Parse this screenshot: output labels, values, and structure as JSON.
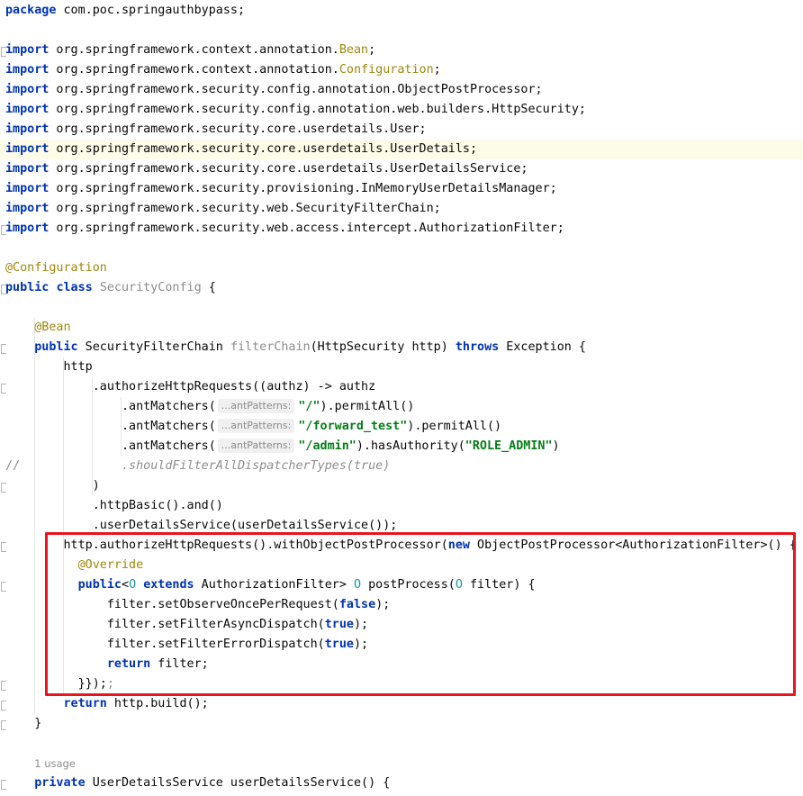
{
  "editor": {
    "lines": [
      {
        "tokens": [
          {
            "t": "package",
            "c": "kw"
          },
          {
            "t": " com.poc.springauthbypass;"
          }
        ]
      },
      {
        "tokens": []
      },
      {
        "tokens": [
          {
            "t": "import",
            "c": "kw"
          },
          {
            "t": " org.springframework.context.annotation."
          },
          {
            "t": "Bean",
            "c": "cls"
          },
          {
            "t": ";"
          }
        ]
      },
      {
        "tokens": [
          {
            "t": "import",
            "c": "kw"
          },
          {
            "t": " org.springframework.context.annotation."
          },
          {
            "t": "Configuration",
            "c": "cls"
          },
          {
            "t": ";"
          }
        ]
      },
      {
        "tokens": [
          {
            "t": "import",
            "c": "kw"
          },
          {
            "t": " org.springframework.security.config.annotation.ObjectPostProcessor;"
          }
        ]
      },
      {
        "tokens": [
          {
            "t": "import",
            "c": "kw"
          },
          {
            "t": " org.springframework.security.config.annotation.web.builders.HttpSecurity;"
          }
        ]
      },
      {
        "tokens": [
          {
            "t": "import",
            "c": "kw"
          },
          {
            "t": " org.springframework.security.core.userdetails.User;"
          }
        ]
      },
      {
        "tokens": [
          {
            "t": "import",
            "c": "kw"
          },
          {
            "t": " org.springframework.security.core.userdetails.UserDetails;"
          }
        ],
        "caret": true
      },
      {
        "tokens": [
          {
            "t": "import",
            "c": "kw"
          },
          {
            "t": " org.springframework.security.core.userdetails.UserDetailsService;"
          }
        ]
      },
      {
        "tokens": [
          {
            "t": "import",
            "c": "kw"
          },
          {
            "t": " org.springframework.security.provisioning.InMemoryUserDetailsManager;"
          }
        ]
      },
      {
        "tokens": [
          {
            "t": "import",
            "c": "kw"
          },
          {
            "t": " org.springframework.security.web.SecurityFilterChain;"
          }
        ]
      },
      {
        "tokens": [
          {
            "t": "import",
            "c": "kw"
          },
          {
            "t": " org.springframework.security.web.access.intercept.AuthorizationFilter;"
          }
        ]
      },
      {
        "tokens": []
      },
      {
        "tokens": [
          {
            "t": "@Configuration",
            "c": "ann"
          }
        ]
      },
      {
        "tokens": [
          {
            "t": "public",
            "c": "kw"
          },
          {
            "t": " "
          },
          {
            "t": "class",
            "c": "kw"
          },
          {
            "t": " "
          },
          {
            "t": "SecurityConfig",
            "c": "gray"
          },
          {
            "t": " {"
          }
        ]
      },
      {
        "tokens": []
      },
      {
        "tokens": [
          {
            "t": "    "
          },
          {
            "t": "@Bean",
            "c": "ann"
          }
        ]
      },
      {
        "tokens": [
          {
            "t": "    "
          },
          {
            "t": "public",
            "c": "kw"
          },
          {
            "t": " SecurityFilterChain "
          },
          {
            "t": "filterChain",
            "c": "gray"
          },
          {
            "t": "(HttpSecurity http) "
          },
          {
            "t": "throws",
            "c": "kw"
          },
          {
            "t": " Exception {"
          }
        ]
      },
      {
        "tokens": [
          {
            "t": "        http"
          }
        ]
      },
      {
        "tokens": [
          {
            "t": "            .authorizeHttpRequests((authz) -> authz"
          }
        ]
      },
      {
        "tokens": [
          {
            "t": "                .antMatchers("
          },
          {
            "t": "...antPatterns:",
            "c": "hint"
          },
          {
            "t": "\"/\"",
            "c": "str"
          },
          {
            "t": ").permitAll()"
          }
        ]
      },
      {
        "tokens": [
          {
            "t": "                .antMatchers("
          },
          {
            "t": "...antPatterns:",
            "c": "hint"
          },
          {
            "t": "\"/forward_test\"",
            "c": "str"
          },
          {
            "t": ").permitAll()"
          }
        ]
      },
      {
        "tokens": [
          {
            "t": "                .antMatchers("
          },
          {
            "t": "...antPatterns:",
            "c": "hint"
          },
          {
            "t": "\"/admin\"",
            "c": "str"
          },
          {
            "t": ").hasAuthority("
          },
          {
            "t": "\"ROLE_ADMIN\"",
            "c": "str"
          },
          {
            "t": ")"
          }
        ]
      },
      {
        "tokens": [
          {
            "t": "                "
          },
          {
            "t": ".shouldFilterAllDispatcherTypes(true)",
            "c": "gray italic"
          }
        ],
        "gutter_comment": "//"
      },
      {
        "tokens": [
          {
            "t": "            )"
          }
        ]
      },
      {
        "tokens": [
          {
            "t": "            .httpBasic().and()"
          }
        ]
      },
      {
        "tokens": [
          {
            "t": "            .userDetailsService(userDetailsService());"
          }
        ]
      },
      {
        "tokens": [
          {
            "t": "        http.authorizeHttpRequests().withObjectPostProcessor("
          },
          {
            "t": "new",
            "c": "kw"
          },
          {
            "t": " ObjectPostProcessor<AuthorizationFilter>() {"
          }
        ]
      },
      {
        "tokens": [
          {
            "t": "          "
          },
          {
            "t": "@Override",
            "c": "ann"
          }
        ]
      },
      {
        "tokens": [
          {
            "t": "          "
          },
          {
            "t": "public",
            "c": "kw"
          },
          {
            "t": "<"
          },
          {
            "t": "O",
            "c": "tp"
          },
          {
            "t": " "
          },
          {
            "t": "extends",
            "c": "kw"
          },
          {
            "t": " AuthorizationFilter> "
          },
          {
            "t": "O",
            "c": "tp"
          },
          {
            "t": " postProcess("
          },
          {
            "t": "O",
            "c": "tp"
          },
          {
            "t": " filter) {"
          }
        ]
      },
      {
        "tokens": [
          {
            "t": "              filter.setObserveOncePerRequest("
          },
          {
            "t": "false",
            "c": "kw"
          },
          {
            "t": ");"
          }
        ]
      },
      {
        "tokens": [
          {
            "t": "              filter.setFilterAsyncDispatch("
          },
          {
            "t": "true",
            "c": "kw"
          },
          {
            "t": ");"
          }
        ]
      },
      {
        "tokens": [
          {
            "t": "              filter.setFilterErrorDispatch("
          },
          {
            "t": "true",
            "c": "kw"
          },
          {
            "t": ");"
          }
        ]
      },
      {
        "tokens": [
          {
            "t": "              "
          },
          {
            "t": "return",
            "c": "kw"
          },
          {
            "t": " filter;"
          }
        ]
      },
      {
        "tokens": [
          {
            "t": "          }});"
          },
          {
            "t": ";",
            "c": "gray"
          }
        ]
      },
      {
        "tokens": [
          {
            "t": "        "
          },
          {
            "t": "return",
            "c": "kw"
          },
          {
            "t": " http.build();"
          }
        ]
      },
      {
        "tokens": [
          {
            "t": "    }"
          }
        ]
      },
      {
        "tokens": []
      },
      {
        "tokens": [
          {
            "t": "    "
          },
          {
            "t": "1 usage",
            "c": "usage"
          }
        ]
      },
      {
        "tokens": [
          {
            "t": "    "
          },
          {
            "t": "private",
            "c": "kw"
          },
          {
            "t": " UserDetailsService userDetailsService() {"
          }
        ]
      }
    ]
  },
  "colors": {
    "keyword": "#0033b3",
    "annotation": "#9e880d",
    "string": "#067d17",
    "comment": "#8c8c8c",
    "type_param": "#20999d",
    "highlight_box": "#e8141e",
    "caret_line": "#fdfce9"
  }
}
